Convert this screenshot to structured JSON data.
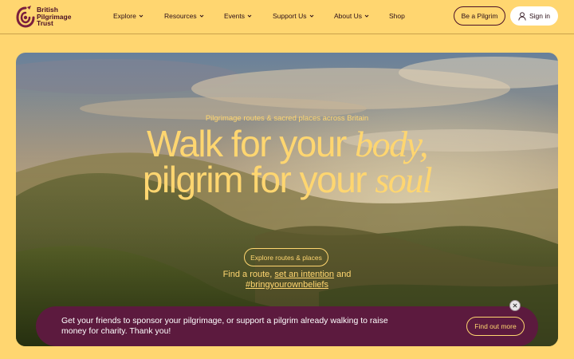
{
  "brand": {
    "name_lines": [
      "British",
      "Pilgrimage",
      "Trust"
    ],
    "color": "#4a0f26"
  },
  "nav": {
    "items": [
      {
        "label": "Explore",
        "has_dropdown": true
      },
      {
        "label": "Resources",
        "has_dropdown": true
      },
      {
        "label": "Events",
        "has_dropdown": true
      },
      {
        "label": "Support Us",
        "has_dropdown": true
      },
      {
        "label": "About Us",
        "has_dropdown": true
      },
      {
        "label": "Shop",
        "has_dropdown": false
      }
    ],
    "be_pilgrim_label": "Be a Pilgrim",
    "signin_label": "Sign in"
  },
  "hero": {
    "subtitle": "Pilgrimage routes & sacred places across Britain",
    "title_line1_plain": "Walk for your ",
    "title_line1_emph": "body,",
    "title_line2_plain": "pilgrim for your ",
    "title_line2_emph": "soul",
    "cta_label": "Explore routes & places",
    "find_prefix": "Find a route, ",
    "find_link": "set an intention",
    "find_suffix": " and",
    "hashtag": "#bringyourownbeliefs"
  },
  "banner": {
    "text": "Get your friends to sponsor your pilgrimage, or support a pilgrim already walking to raise money for charity. Thank you!",
    "button_label": "Find out more"
  },
  "colors": {
    "page_bg": "#FFD670",
    "accent": "#FFD670",
    "banner_bg": "#5c1a3e"
  },
  "icons": {
    "logo": "spiral-logo-icon",
    "dropdown": "chevron-down-icon",
    "user": "user-icon",
    "close": "close-icon"
  }
}
